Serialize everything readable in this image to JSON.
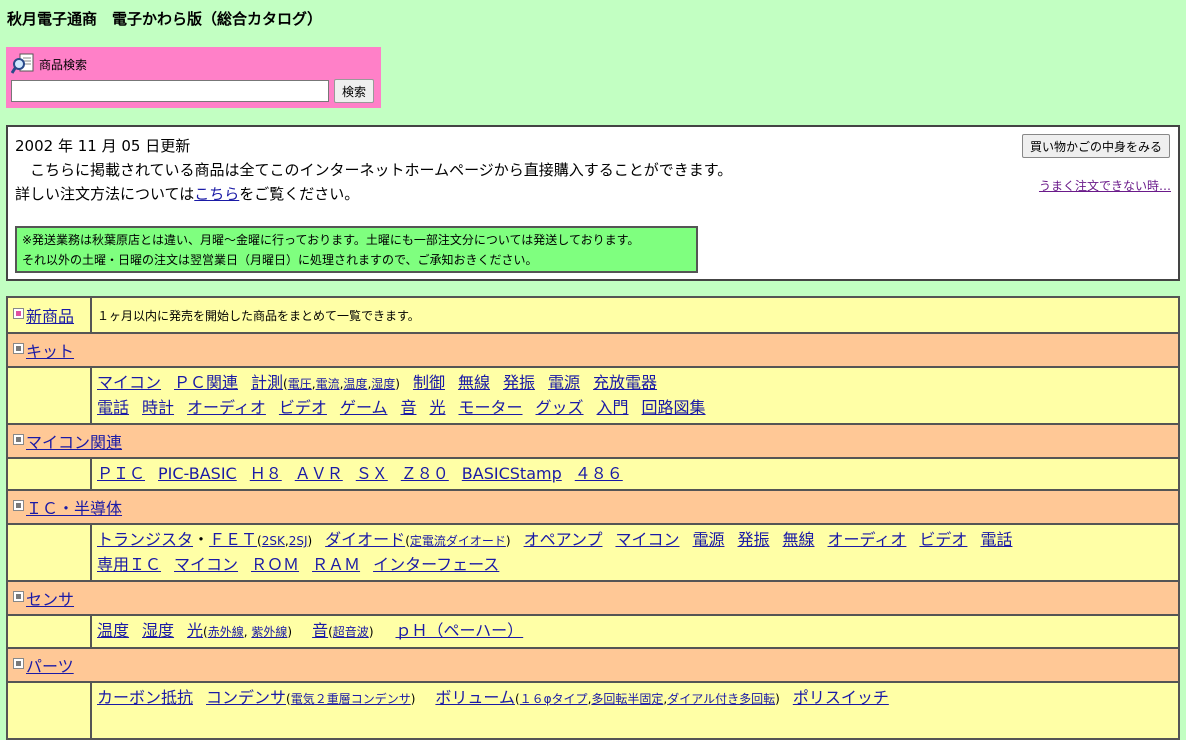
{
  "page_title": "秋月電子通商　電子かわら版（総合カタログ）",
  "search": {
    "label": "商品検索",
    "button": "検索",
    "value": ""
  },
  "info": {
    "updated": "2002 年 11 月 05 日更新",
    "line2": "　こちらに掲載されている商品は全てこのインターネットホームページから直接購入することができます。",
    "line3_pre": "詳しい注文方法については",
    "line3_link": "こちら",
    "line3_post": "をご覧ください。",
    "cart_button": "買い物かごの中身をみる",
    "trouble_link": "うまく注文できない時…",
    "notice_1": "※発送業務は秋葉原店とは違い、月曜～金曜に行っております。土曜にも一部注文分については発送しております。",
    "notice_2": "それ以外の土曜・日曜の注文は翌営業日（月曜日）に処理されますので、ご承知おきください。"
  },
  "catalog": {
    "new": {
      "title": "新商品",
      "desc": "１ヶ月以内に発売を開始した商品をまとめて一覧できます。"
    },
    "kit": {
      "title": "キット",
      "line1": [
        "マイコン",
        "ＰＣ関連"
      ],
      "measure": "計測",
      "measure_open": "(",
      "measure_sub": [
        "電圧",
        "電流",
        "温度",
        "湿度"
      ],
      "measure_close": ")",
      "line1_rest": [
        "制御",
        "無線",
        "発振",
        "電源",
        "充放電器"
      ],
      "line2": [
        "電話",
        "時計",
        "オーディオ",
        "ビデオ",
        "ゲーム",
        "音",
        "光",
        "モーター",
        "グッズ",
        "入門",
        "回路図集"
      ]
    },
    "micom": {
      "title": "マイコン関連",
      "items": [
        "ＰＩＣ",
        "PIC-BASIC",
        "Ｈ８",
        "ＡＶＲ",
        "ＳＸ",
        "Ｚ８０",
        "BASICStamp",
        "４８６"
      ]
    },
    "ic": {
      "title": "ＩＣ・半導体",
      "tr": "トランジスタ",
      "dot": "・",
      "fet": "ＦＥＴ",
      "fet_open": "(",
      "fet_sub": [
        "2SK",
        "2SJ"
      ],
      "fet_close": ")",
      "diode": "ダイオード",
      "diode_open": "(",
      "diode_sub": "定電流ダイオード",
      "diode_close": ")",
      "line1_rest": [
        "オペアンプ",
        "マイコン",
        "電源",
        "発振",
        "無線",
        "オーディオ",
        "ビデオ",
        "電話"
      ],
      "line2": [
        "専用ＩＣ",
        "マイコン",
        "ＲＯＭ",
        "ＲＡＭ",
        "インターフェース"
      ]
    },
    "sensor": {
      "title": "センサ",
      "temp": "温度",
      "humid": "湿度",
      "light": "光",
      "light_open": "(",
      "light_sub": [
        "赤外線",
        "紫外線"
      ],
      "light_close": ")",
      "sound": "音",
      "sound_open": "(",
      "sound_sub": "超音波",
      "sound_close": ")",
      "ph": "ｐＨ（ペーハー）"
    },
    "parts": {
      "title": "パーツ",
      "carbon": "カーボン抵抗",
      "cond": "コンデンサ",
      "cond_open": "(",
      "cond_sub": "電気２重層コンデンサ",
      "cond_close": ")",
      "vol": "ボリューム",
      "vol_open": "(",
      "vol_sub": [
        "１６φタイプ",
        "多回転半固定",
        "ダイアル付き多回転"
      ],
      "vol_close": ")",
      "poly": "ポリスイッチ"
    }
  },
  "colors": {
    "background": "#c2ffc2",
    "search_box": "#ff80c8",
    "notice": "#7fff7f",
    "category_row": "#ffc896",
    "content_row": "#ffffa6",
    "link": "#1a1aa6"
  }
}
